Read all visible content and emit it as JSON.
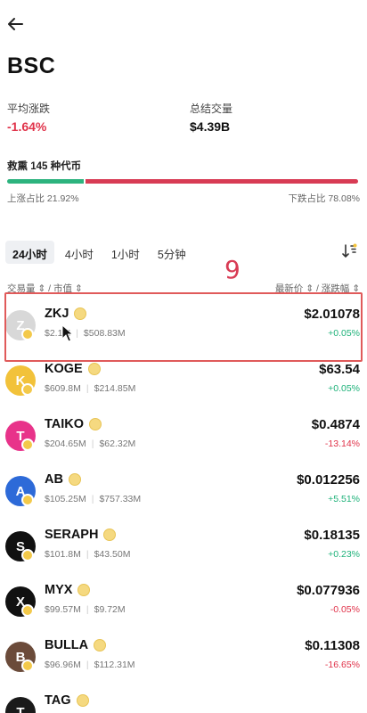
{
  "header": {
    "back_label": "←",
    "title": "BSC"
  },
  "stats": {
    "avg_change_label": "平均涨跌",
    "avg_change_value": "-1.64%",
    "total_volume_label": "总结交量",
    "total_volume_value": "$4.39B"
  },
  "token_count": "救熏 145 种代币",
  "ratio": {
    "up_fraction": 0.2192,
    "up_label": "上涨占比 21.92%",
    "down_label": "下跌占比 78.08%"
  },
  "tabs": [
    {
      "label": "24小时",
      "active": true
    },
    {
      "label": "4小时",
      "active": false
    },
    {
      "label": "1小时",
      "active": false
    },
    {
      "label": "5分钟",
      "active": false
    }
  ],
  "page_badge": "9",
  "columns": {
    "left": "交易量 ⇕ / 市值 ⇕",
    "right": "最新价 ⇕ / 涨跌幅 ⇕"
  },
  "colors": {
    "accent_negative": "#e0334a",
    "accent_positive": "#1fb27a",
    "highlight_border": "#e05a5a"
  },
  "tokens": [
    {
      "symbol": "ZKJ",
      "volume": "$2.1M",
      "market_cap": "$508.83M",
      "price": "$2.01078",
      "change": "+0.05%",
      "direction": "up",
      "icon": "zkj-logo-icon",
      "avatar_bg": "#d8d8d8",
      "avatar_glyph": "Z"
    },
    {
      "symbol": "KOGE",
      "volume": "$609.8M",
      "market_cap": "$214.85M",
      "price": "$63.54",
      "change": "+0.05%",
      "direction": "up",
      "icon": "koge-logo-icon",
      "avatar_bg": "#f2c23a",
      "avatar_glyph": "K"
    },
    {
      "symbol": "TAIKO",
      "volume": "$204.65M",
      "market_cap": "$62.32M",
      "price": "$0.4874",
      "change": "-13.14%",
      "direction": "down",
      "icon": "taiko-logo-icon",
      "avatar_bg": "#e8338a",
      "avatar_glyph": "T"
    },
    {
      "symbol": "AB",
      "volume": "$105.25M",
      "market_cap": "$757.33M",
      "price": "$0.012256",
      "change": "+5.51%",
      "direction": "up",
      "icon": "ab-logo-icon",
      "avatar_bg": "#2d6ad8",
      "avatar_glyph": "A"
    },
    {
      "symbol": "SERAPH",
      "volume": "$101.8M",
      "market_cap": "$43.50M",
      "price": "$0.18135",
      "change": "+0.23%",
      "direction": "up",
      "icon": "seraph-logo-icon",
      "avatar_bg": "#111111",
      "avatar_glyph": "S"
    },
    {
      "symbol": "MYX",
      "volume": "$99.57M",
      "market_cap": "$9.72M",
      "price": "$0.077936",
      "change": "-0.05%",
      "direction": "down",
      "icon": "myx-logo-icon",
      "avatar_bg": "#111111",
      "avatar_glyph": "X"
    },
    {
      "symbol": "BULLA",
      "volume": "$96.96M",
      "market_cap": "$112.31M",
      "price": "$0.11308",
      "change": "-16.65%",
      "direction": "down",
      "icon": "bulla-logo-icon",
      "avatar_bg": "#6b4b3a",
      "avatar_glyph": "B"
    },
    {
      "symbol": "TAG",
      "volume": "",
      "market_cap": "",
      "price": "",
      "change": "",
      "direction": "up",
      "icon": "tag-logo-icon",
      "avatar_bg": "#1a1a1a",
      "avatar_glyph": "T"
    }
  ]
}
